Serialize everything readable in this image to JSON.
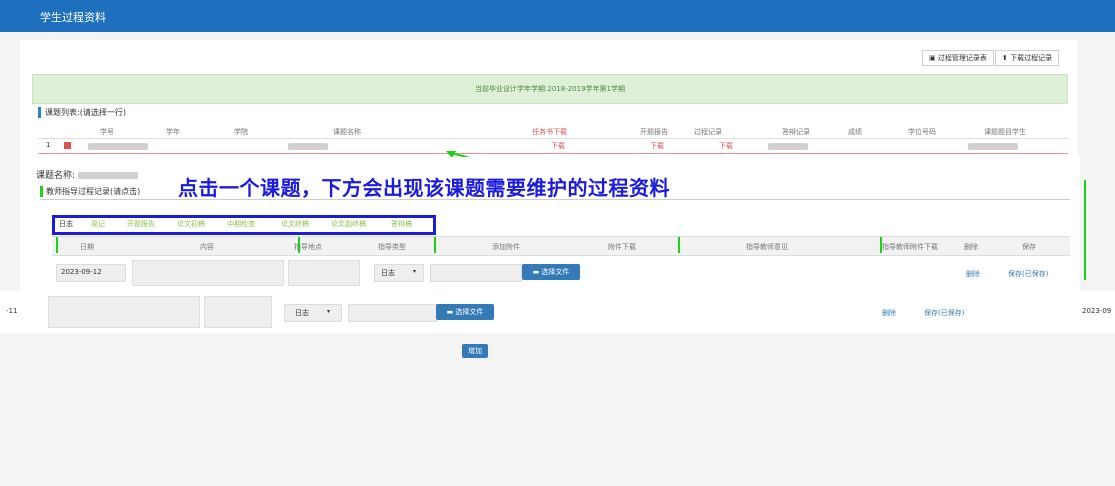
{
  "app": {
    "title": "学生过程资料"
  },
  "toolbar": {
    "record_table": "过程管理记录表",
    "download": "下载过程记录"
  },
  "semester_banner": "当前毕业设计学年学期:2018-2019学年第1学期",
  "topic_list": {
    "title": "课题列表:(请选择一行)",
    "columns": [
      "学号",
      "学年",
      "学院",
      "课题名称",
      "任务书下载",
      "开题报告",
      "过程记录",
      "答辩记录",
      "成绩",
      "学位号码",
      "课题题目学生"
    ],
    "row": {
      "index": "1",
      "downloads": [
        "下载",
        "下载",
        "下载"
      ]
    }
  },
  "topic_name_label": "课题名称:",
  "teacher_records_title": "教师指导过程记录(请点击)",
  "annotation": "点击一个课题，下方会出现该课题需要维护的过程资料",
  "tabs": [
    "日志",
    "周记",
    "开题报告",
    "论文初稿",
    "中期检查",
    "论文终稿",
    "论文副终稿",
    "答辩稿"
  ],
  "grid": {
    "columns": [
      "日期",
      "内容",
      "指导地点",
      "指导类型",
      "添加附件",
      "附件下载",
      "指导教师意见",
      "指导教师附件下载",
      "删除",
      "保存"
    ],
    "row1": {
      "date": "2023-09-12",
      "type": "日志",
      "select": "选择文件",
      "delete": "删除",
      "save": "保存(已保存)"
    },
    "row2": {
      "date_left": "-11",
      "type": "日志",
      "select": "选择文件",
      "delete": "删除",
      "save": "保存(已保存)",
      "date_right": "2023-09"
    }
  },
  "add_button": "增加",
  "colors": {
    "topbar": "#1f6fbf",
    "annotation": "#1a1ae0",
    "green_marker": "#18d418"
  }
}
